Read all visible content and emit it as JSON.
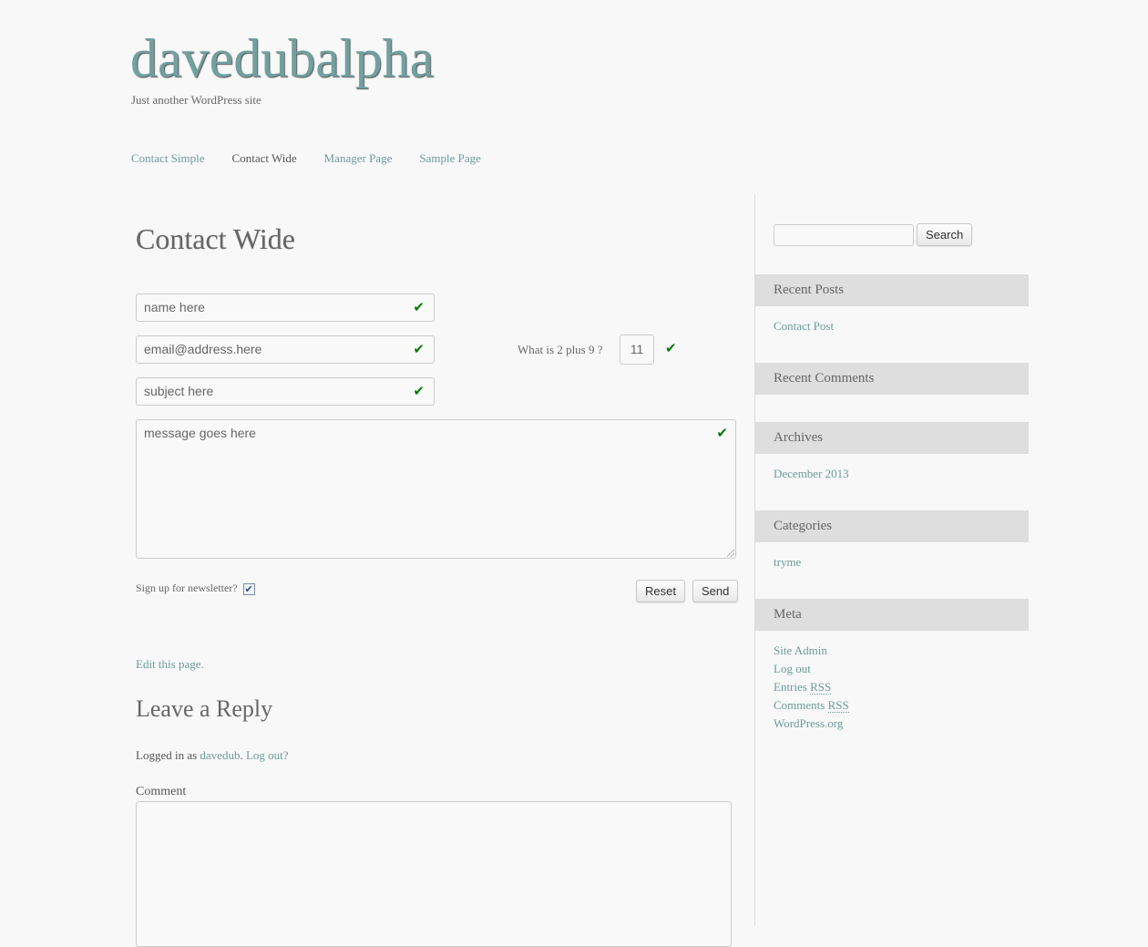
{
  "header": {
    "site_title": "davedubalpha",
    "tagline": "Just another WordPress site"
  },
  "nav": {
    "items": [
      {
        "label": "Contact Simple",
        "current": false
      },
      {
        "label": "Contact Wide",
        "current": true
      },
      {
        "label": "Manager Page",
        "current": false
      },
      {
        "label": "Sample Page",
        "current": false
      }
    ]
  },
  "main": {
    "page_title": "Contact Wide",
    "form": {
      "name_value": "name here",
      "email_value": "email@address.here",
      "subject_value": "subject here",
      "message_value": "message goes here",
      "captcha_question": "What is 2 plus 9 ?",
      "captcha_value": "11",
      "newsletter_label": "Sign up for newsletter?",
      "newsletter_checked": true,
      "checkbox_mark": "✔",
      "valid_mark": "✔",
      "reset_label": "Reset",
      "send_label": "Send"
    },
    "edit_link": "Edit this page.",
    "reply": {
      "title": "Leave a Reply",
      "logged_in_prefix": "Logged in as ",
      "username": "davedub",
      "logout_link": "Log out?",
      "comment_label": "Comment",
      "comment_value": ""
    }
  },
  "sidebar": {
    "search": {
      "value": "",
      "button_label": "Search"
    },
    "widgets": {
      "recent_posts": {
        "title": "Recent Posts",
        "items": [
          "Contact Post"
        ]
      },
      "recent_comments": {
        "title": "Recent Comments",
        "items": []
      },
      "archives": {
        "title": "Archives",
        "items": [
          "December 2013"
        ]
      },
      "categories": {
        "title": "Categories",
        "items": [
          "tryme"
        ]
      },
      "meta": {
        "title": "Meta",
        "items": [
          "Site Admin",
          "Log out",
          "Entries",
          "Comments",
          "WordPress.org"
        ],
        "rss_abbr": "RSS"
      }
    }
  },
  "colors": {
    "link": "#6c9a9a",
    "title": "#72a0a0",
    "valid_check": "#0a7a0a",
    "widget_header_bg": "#dedede",
    "page_bg": "#f8f8f8"
  }
}
